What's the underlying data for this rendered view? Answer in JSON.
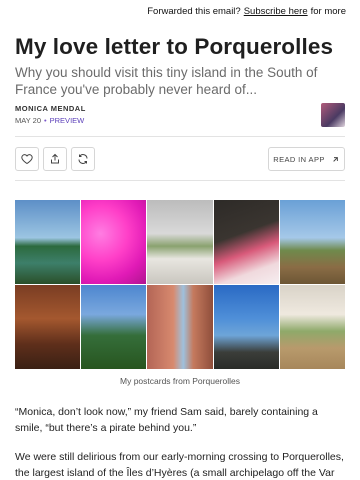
{
  "topbar": {
    "prefix": "Forwarded this email?",
    "link": "Subscribe here",
    "suffix": "for more"
  },
  "post": {
    "title": "My love letter to Porquerolles",
    "subtitle": "Why you should visit this tiny island in the South of France you've probably never heard of...",
    "author": "MONICA MENDAL",
    "date": "MAY 20",
    "preview_label": "PREVIEW"
  },
  "actions": {
    "like_icon": "heart-icon",
    "share_icon": "share-icon",
    "restack_icon": "restack-icon",
    "read_in_app_label": "READ IN APP"
  },
  "gallery": {
    "caption": "My postcards from Porquerolles",
    "tiles": [
      "island coast",
      "pink room",
      "terrace",
      "tasting menu",
      "vineyard",
      "wooden interior",
      "forest path",
      "pink houses",
      "beach bay",
      "gallery hall"
    ]
  },
  "body": {
    "paragraph_1": "“Monica, don’t look now,” my friend Sam said, barely containing a smile, “but there’s a pirate behind you.”",
    "paragraph_2": "We were still delirious from our early-morning crossing to Porquerolles, the largest island of the Îles d’Hyères (a small archipelago off the Var coast, on"
  }
}
